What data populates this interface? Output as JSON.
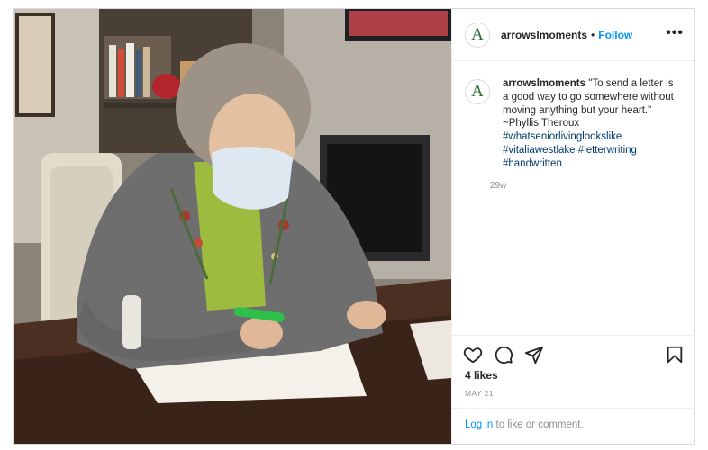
{
  "post": {
    "author": {
      "handle": "arrowslmoments",
      "avatar_letter": "A"
    },
    "follow_separator": "•",
    "follow_label": "Follow",
    "more_label": "•••",
    "caption": {
      "handle": "arrowslmoments",
      "text_line": "\"To send a letter is a good way to go somewhere without moving anything but your heart.\"",
      "attribution": "~Phyllis Theroux",
      "hashtags": [
        "#whatseniorlivinglookslike",
        "#vitaliawestlake",
        "#letterwriting",
        "#handwritten"
      ]
    },
    "comment_time": "29w",
    "likes": "4 likes",
    "date": "MAY 21",
    "login": {
      "link": "Log in",
      "rest": " to like or comment."
    },
    "icons": {
      "like": "heart-icon",
      "comment": "comment-icon",
      "share": "share-icon",
      "save": "bookmark-icon"
    }
  }
}
